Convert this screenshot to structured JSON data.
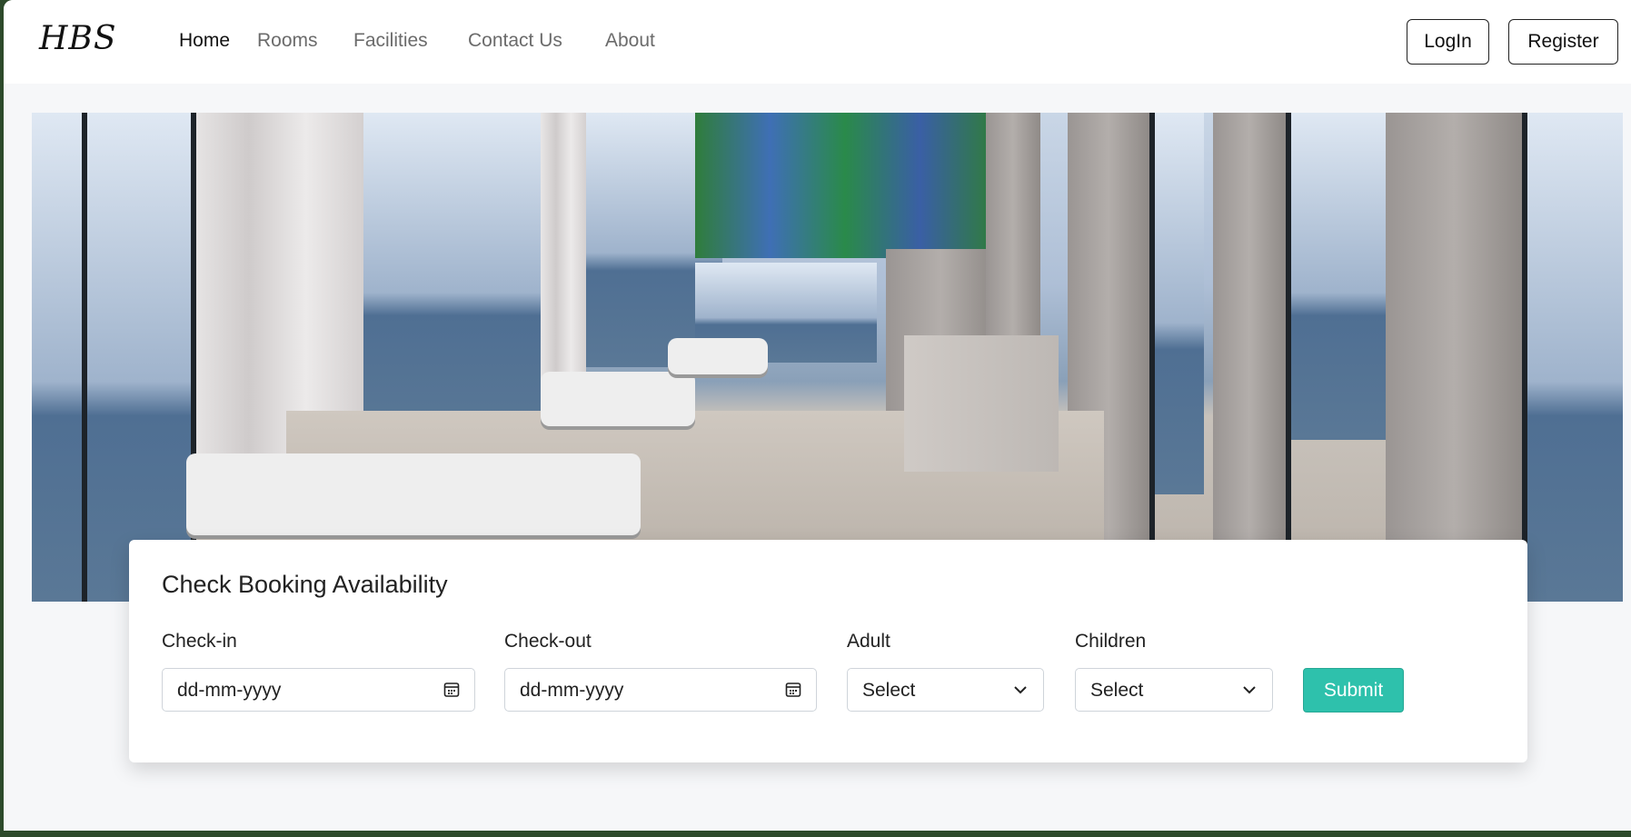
{
  "nav": {
    "logo": "HBS",
    "links": [
      {
        "label": "Home",
        "active": true
      },
      {
        "label": "Rooms",
        "active": false
      },
      {
        "label": "Facilities",
        "active": false
      },
      {
        "label": "Contact Us",
        "active": false
      },
      {
        "label": "About",
        "active": false
      }
    ],
    "login_label": "LogIn",
    "register_label": "Register"
  },
  "hero": {
    "image": "hotel-lobby-photo"
  },
  "booking": {
    "title": "Check Booking Availability",
    "checkin": {
      "label": "Check-in",
      "placeholder": "dd-mm-yyyy",
      "icon": "calendar-icon"
    },
    "checkout": {
      "label": "Check-out",
      "placeholder": "dd-mm-yyyy",
      "icon": "calendar-icon"
    },
    "adult": {
      "label": "Adult",
      "selected": "Select",
      "icon": "chevron-down-icon"
    },
    "children": {
      "label": "Children",
      "selected": "Select",
      "icon": "chevron-down-icon"
    },
    "submit_label": "Submit"
  },
  "colors": {
    "accent": "#2ec1ac",
    "page_bg": "#f6f7f9",
    "frame": "#2d4a2b"
  }
}
